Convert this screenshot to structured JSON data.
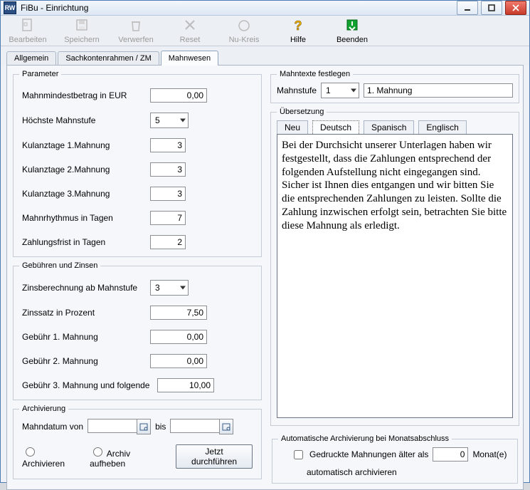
{
  "window": {
    "title": "FiBu - Einrichtung",
    "app_icon_text": "RW"
  },
  "win_controls": {
    "min": "minimize",
    "max": "maximize",
    "close": "close"
  },
  "toolbar": {
    "edit": "Bearbeiten",
    "save": "Speichern",
    "discard": "Verwerfen",
    "reset": "Reset",
    "nukreis": "Nu-Kreis",
    "help": "Hilfe",
    "end": "Beenden"
  },
  "tabs": [
    "Allgemein",
    "Sachkontenrahmen / ZM",
    "Mahnwesen"
  ],
  "active_tab": 2,
  "parameter": {
    "legend": "Parameter",
    "mahnmin_label": "Mahnmindestbetrag in EUR",
    "mahnmin_value": "0,00",
    "hoechste_label": "Höchste Mahnstufe",
    "hoechste_value": "5",
    "kulanz1_label": "Kulanztage 1.Mahnung",
    "kulanz1_value": "3",
    "kulanz2_label": "Kulanztage 2.Mahnung",
    "kulanz2_value": "3",
    "kulanz3_label": "Kulanztage 3.Mahnung",
    "kulanz3_value": "3",
    "rhythmus_label": "Mahnrhythmus in Tagen",
    "rhythmus_value": "7",
    "zfrist_label": "Zahlungsfrist in Tagen",
    "zfrist_value": "2"
  },
  "gebuehren": {
    "legend": "Gebühren und Zinsen",
    "zinsab_label": "Zinsberechnung ab Mahnstufe",
    "zinsab_value": "3",
    "zinssatz_label": "Zinssatz in Prozent",
    "zinssatz_value": "7,50",
    "geb1_label": "Gebühr 1. Mahnung",
    "geb1_value": "0,00",
    "geb2_label": "Gebühr 2. Mahnung",
    "geb2_value": "0,00",
    "geb3_label": "Gebühr 3. Mahnung und folgende",
    "geb3_value": "10,00"
  },
  "archiv": {
    "legend": "Archivierung",
    "von_label": "Mahndatum von",
    "bis_label": "bis",
    "von_value": "",
    "bis_value": "",
    "opt_archivieren": "Archivieren",
    "opt_aufheben": "Archiv aufheben",
    "button": "Jetzt durchführen"
  },
  "mahntexte": {
    "legend": "Mahntexte festlegen",
    "stufe_label": "Mahnstufe",
    "stufe_value": "1",
    "name_value": "1. Mahnung"
  },
  "ueber": {
    "legend": "Übersetzung",
    "tabs": [
      "Neu",
      "Deutsch",
      "Spanisch",
      "Englisch"
    ],
    "active": 1,
    "text": "Bei der Durchsicht unserer Unterlagen haben wir festgestellt, dass die Zahlungen entsprechend der folgenden Aufstellung nicht eingegangen sind. Sicher ist Ihnen dies entgangen und wir bitten Sie die entsprechenden Zahlungen zu leisten. Sollte die Zahlung inzwischen erfolgt sein, betrachten Sie bitte diese Mahnung als erledigt."
  },
  "auto_arch": {
    "legend": "Automatische Archivierung bei Monatsabschluss",
    "line1_a": "Gedruckte Mahnungen älter als",
    "line1_val": "0",
    "line1_b": "Monat(e)",
    "line2": "automatisch archivieren"
  }
}
